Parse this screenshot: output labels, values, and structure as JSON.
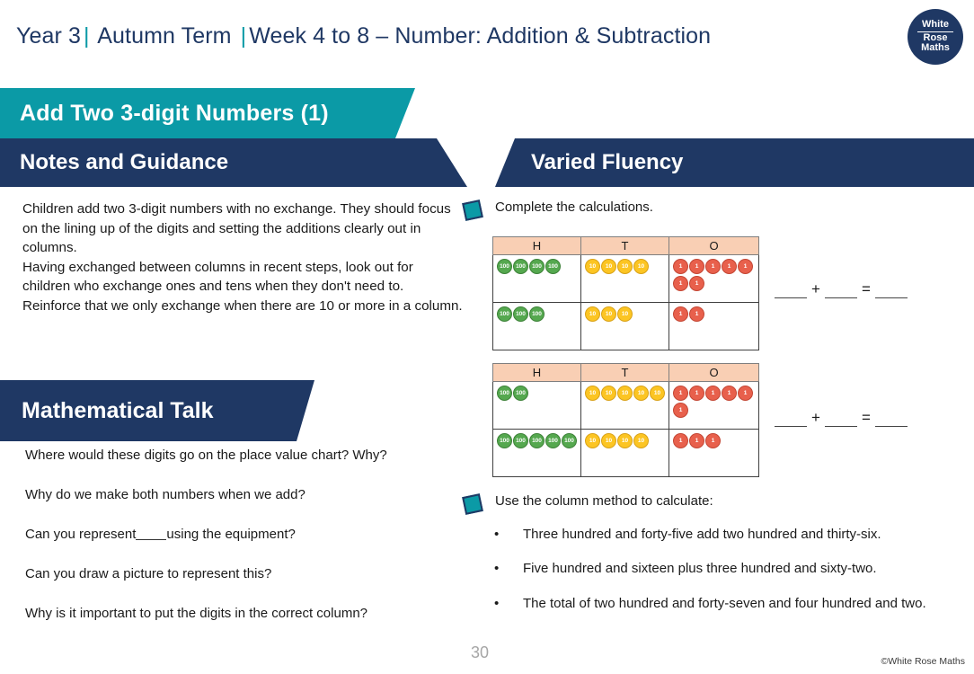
{
  "header": {
    "year": "Year 3",
    "term": "Autumn Term",
    "week": "Week 4 to 8 – Number: Addition & Subtraction",
    "separator": "|",
    "accent_color": "#0b9aa6",
    "navy_color": "#1f3864"
  },
  "logo": {
    "line1": "White",
    "line2": "Rose",
    "line3": "Maths"
  },
  "title_banner": {
    "label": "Add Two 3-digit Numbers (1)",
    "color": "#0b9aa6"
  },
  "notes_section": {
    "heading": "Notes and Guidance",
    "paragraphs": [
      "Children add two 3-digit numbers with no exchange. They should focus on the lining up of the digits and setting the additions clearly out in columns.",
      "Having exchanged between columns in recent steps, look out for children who exchange ones and tens when they don't need to.",
      "Reinforce that we only exchange when there are 10 or more in a column."
    ]
  },
  "math_talk": {
    "heading": "Mathematical Talk",
    "questions": [
      {
        "before": "Where would these digits go on the place value chart? Why?",
        "after": "",
        "blank": false
      },
      {
        "before": "Why do we make both numbers when we add?",
        "after": "",
        "blank": false
      },
      {
        "before": "Can you represent",
        "after": "using the equipment?",
        "blank": true
      },
      {
        "before": "Can you draw a picture to represent this?",
        "after": "",
        "blank": false
      },
      {
        "before": "Why is it important to put the digits in the correct column?",
        "after": "",
        "blank": false
      }
    ]
  },
  "varied_fluency": {
    "heading": "Varied Fluency",
    "task1_label": "Complete the calculations.",
    "task2_label": "Use the column method to calculate:",
    "equation_template": {
      "plus": "+",
      "equals": "="
    },
    "bullet_marker": "•",
    "column_method_items": [
      "Three hundred and forty-five add two hundred and thirty-six.",
      "Five hundred and sixteen plus three hundred and sixty-two.",
      "The total of two hundred and forty-seven and four hundred and two."
    ],
    "tables": [
      {
        "headers": [
          "H",
          "T",
          "O"
        ],
        "header_color": "#f9cfb4",
        "rows": [
          {
            "hundreds": 4,
            "tens": 4,
            "ones": 7
          },
          {
            "hundreds": 3,
            "tens": 3,
            "ones": 2
          }
        ]
      },
      {
        "headers": [
          "H",
          "T",
          "O"
        ],
        "header_color": "#f9cfb4",
        "rows": [
          {
            "hundreds": 2,
            "tens": 5,
            "ones": 6
          },
          {
            "hundreds": 5,
            "tens": 4,
            "ones": 3
          }
        ]
      }
    ],
    "counter_labels": {
      "hundred": "100",
      "ten": "10",
      "one": "1"
    },
    "counter_colors": {
      "hundred": "#55a84f",
      "ten": "#fcc523",
      "one": "#e8604c"
    }
  },
  "footer": {
    "page_number": "30",
    "copyright": "©White Rose Maths"
  }
}
